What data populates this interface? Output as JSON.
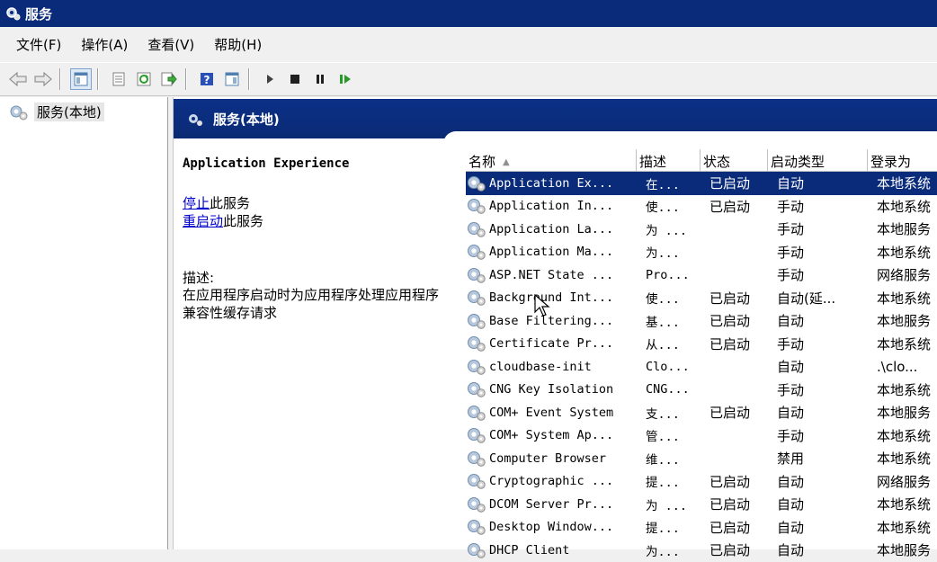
{
  "window": {
    "title": "服务"
  },
  "menu": [
    "文件(F)",
    "操作(A)",
    "查看(V)",
    "帮助(H)"
  ],
  "toolbar": {
    "buttons": [
      "back-icon",
      "forward-icon",
      "show-hide-tree-icon",
      "properties-icon",
      "refresh-icon",
      "export-list-icon",
      "help-icon",
      "show-action-pane-icon",
      "start-icon",
      "stop-icon",
      "pause-icon",
      "restart-icon"
    ]
  },
  "tree": {
    "root": "服务(本地)"
  },
  "main": {
    "header": "服务(本地)",
    "selected_name": "Application Experience",
    "stop_link": "停止",
    "stop_suffix": "此服务",
    "restart_link": "重启动",
    "restart_suffix": "此服务",
    "desc_label": "描述:",
    "desc_text": "在应用程序启动时为应用程序处理应用程序兼容性缓存请求"
  },
  "table": {
    "headers": {
      "name": "名称",
      "sort": "▲",
      "desc": "描述",
      "status": "状态",
      "startup": "启动类型",
      "logon": "登录为"
    },
    "rows": [
      {
        "name": "Application Ex...",
        "desc": "在...",
        "status": "已启动",
        "startup": "自动",
        "logon": "本地系统"
      },
      {
        "name": "Application In...",
        "desc": "使...",
        "status": "已启动",
        "startup": "手动",
        "logon": "本地系统"
      },
      {
        "name": "Application La...",
        "desc": "为 ...",
        "status": "",
        "startup": "手动",
        "logon": "本地服务"
      },
      {
        "name": "Application Ma...",
        "desc": "为...",
        "status": "",
        "startup": "手动",
        "logon": "本地系统"
      },
      {
        "name": "ASP.NET State ...",
        "desc": "Pro...",
        "status": "",
        "startup": "手动",
        "logon": "网络服务"
      },
      {
        "name": "Background Int...",
        "desc": "使...",
        "status": "已启动",
        "startup": "自动(延...",
        "logon": "本地系统"
      },
      {
        "name": "Base Filtering...",
        "desc": "基...",
        "status": "已启动",
        "startup": "自动",
        "logon": "本地服务"
      },
      {
        "name": "Certificate Pr...",
        "desc": "从...",
        "status": "已启动",
        "startup": "手动",
        "logon": "本地系统"
      },
      {
        "name": "cloudbase-init",
        "desc": "Clo...",
        "status": "",
        "startup": "自动",
        "logon": ".\\clo..."
      },
      {
        "name": "CNG Key Isolation",
        "desc": "CNG...",
        "status": "",
        "startup": "手动",
        "logon": "本地系统"
      },
      {
        "name": "COM+ Event System",
        "desc": "支...",
        "status": "已启动",
        "startup": "自动",
        "logon": "本地服务"
      },
      {
        "name": "COM+ System Ap...",
        "desc": "管...",
        "status": "",
        "startup": "手动",
        "logon": "本地系统"
      },
      {
        "name": "Computer Browser",
        "desc": "维...",
        "status": "",
        "startup": "禁用",
        "logon": "本地系统"
      },
      {
        "name": "Cryptographic ...",
        "desc": "提...",
        "status": "已启动",
        "startup": "自动",
        "logon": "网络服务"
      },
      {
        "name": "DCOM Server Pr...",
        "desc": "为 ...",
        "status": "已启动",
        "startup": "自动",
        "logon": "本地系统"
      },
      {
        "name": "Desktop Window...",
        "desc": "提...",
        "status": "已启动",
        "startup": "自动",
        "logon": "本地系统"
      },
      {
        "name": "DHCP Client",
        "desc": "为...",
        "status": "已启动",
        "startup": "自动",
        "logon": "本地服务"
      }
    ]
  },
  "colors": {
    "titlebar": "#0a2b7a",
    "selection": "#0a2b7a",
    "link": "#0000cc"
  }
}
